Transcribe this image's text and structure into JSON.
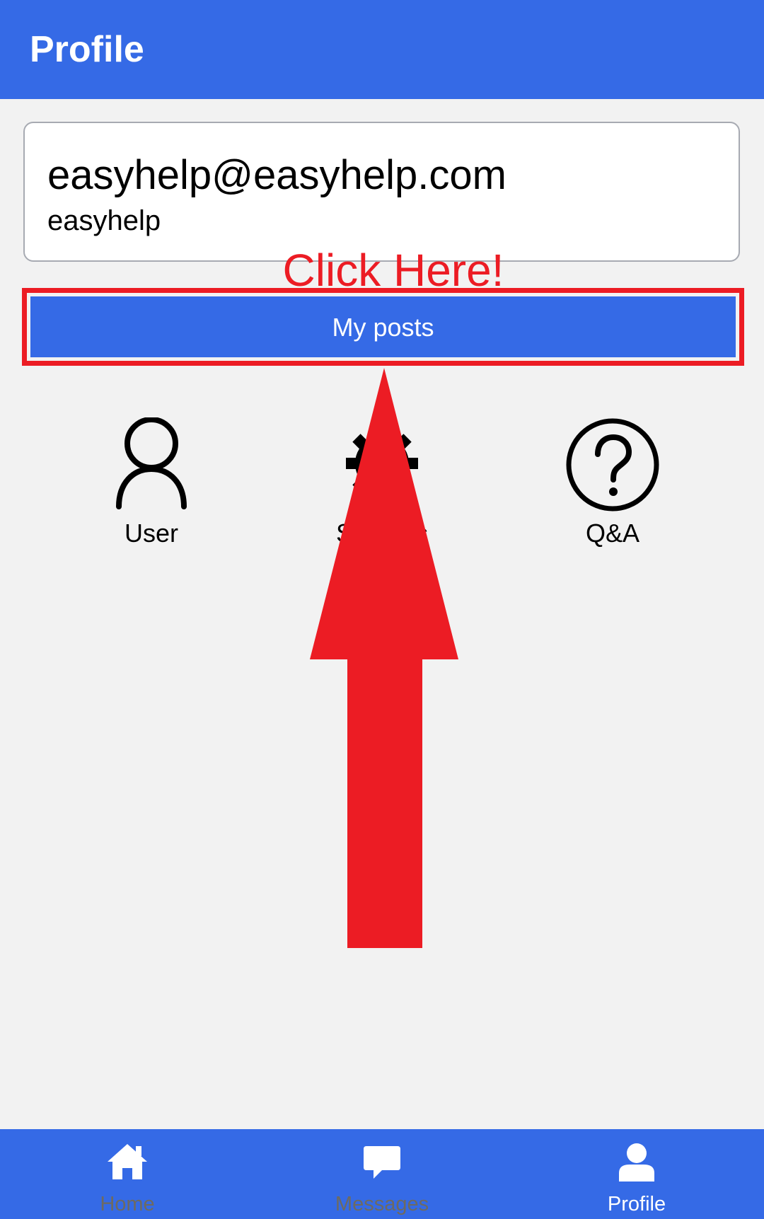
{
  "header": {
    "title": "Profile"
  },
  "account": {
    "email": "easyhelp@easyhelp.com",
    "username": "easyhelp"
  },
  "annotation": {
    "hint": "Click Here!"
  },
  "actions": {
    "my_posts_label": "My posts"
  },
  "shortcuts": [
    {
      "label": "User",
      "icon": "user-icon"
    },
    {
      "label": "Settings",
      "icon": "gear-icon"
    },
    {
      "label": "Q&A",
      "icon": "question-icon"
    }
  ],
  "bottom_nav": [
    {
      "label": "Home",
      "icon": "home-icon",
      "active": false
    },
    {
      "label": "Messages",
      "icon": "message-icon",
      "active": false
    },
    {
      "label": "Profile",
      "icon": "profile-icon",
      "active": true
    }
  ],
  "colors": {
    "brand": "#356ae6",
    "annotation": "#ec1c24",
    "inactive_nav_text": "#6d6a62"
  }
}
